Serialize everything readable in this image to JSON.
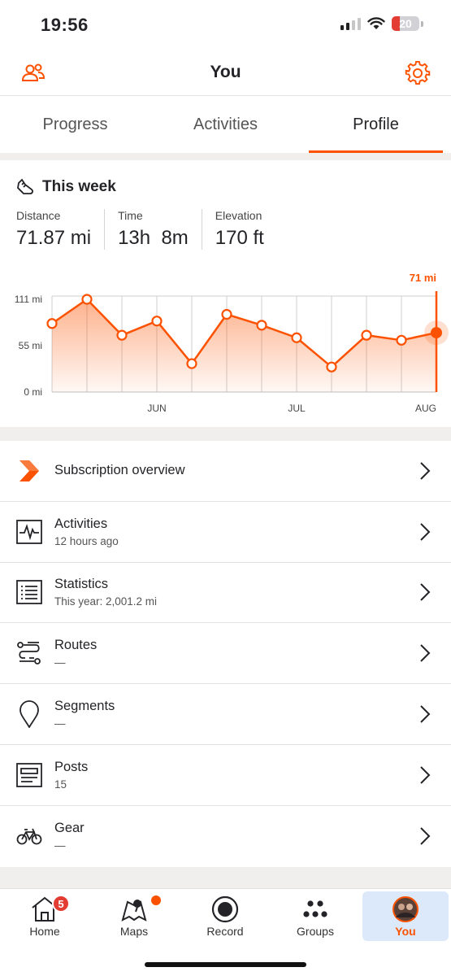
{
  "status_bar": {
    "time": "19:56",
    "battery": "20"
  },
  "header": {
    "title": "You"
  },
  "tabs": [
    {
      "label": "Progress",
      "active": false
    },
    {
      "label": "Activities",
      "active": false
    },
    {
      "label": "Profile",
      "active": true
    }
  ],
  "week": {
    "title": "This week",
    "stats": [
      {
        "label": "Distance",
        "value": "71.87 mi"
      },
      {
        "label": "Time",
        "value": "13h  8m"
      },
      {
        "label": "Elevation",
        "value": "170 ft"
      }
    ]
  },
  "chart_data": {
    "type": "area",
    "title": "",
    "xlabel": "",
    "ylabel": "",
    "y_ticks": [
      "111 mi",
      "55 mi",
      "0 mi"
    ],
    "x_ticks": [
      {
        "label": "JUN",
        "index": 3
      },
      {
        "label": "JUL",
        "index": 7
      },
      {
        "label": "AUG",
        "index": 11
      }
    ],
    "ylim": [
      0,
      111
    ],
    "series": [
      {
        "values": [
          82,
          111,
          68,
          85,
          34,
          93,
          80,
          65,
          30,
          68,
          62,
          71
        ]
      }
    ],
    "current_label": "71 mi",
    "color": "#fc5200"
  },
  "menu": [
    {
      "label": "Subscription overview",
      "sub": "",
      "icon": "subscription-chevron-icon"
    },
    {
      "label": "Activities",
      "sub": "12 hours ago",
      "icon": "activity-pulse-icon"
    },
    {
      "label": "Statistics",
      "sub": "This year: 2,001.2 mi",
      "icon": "statistics-list-icon"
    },
    {
      "label": "Routes",
      "sub": "—",
      "icon": "route-icon"
    },
    {
      "label": "Segments",
      "sub": "—",
      "icon": "map-pin-icon"
    },
    {
      "label": "Posts",
      "sub": "15",
      "icon": "post-icon"
    },
    {
      "label": "Gear",
      "sub": "—",
      "icon": "bicycle-icon"
    }
  ],
  "nav": [
    {
      "label": "Home",
      "badge": "5"
    },
    {
      "label": "Maps"
    },
    {
      "label": "Record"
    },
    {
      "label": "Groups"
    },
    {
      "label": "You",
      "active": true
    }
  ],
  "colors": {
    "accent": "#fc5200",
    "badge": "#e23c33",
    "active_nav_bg": "#dce9fb"
  }
}
